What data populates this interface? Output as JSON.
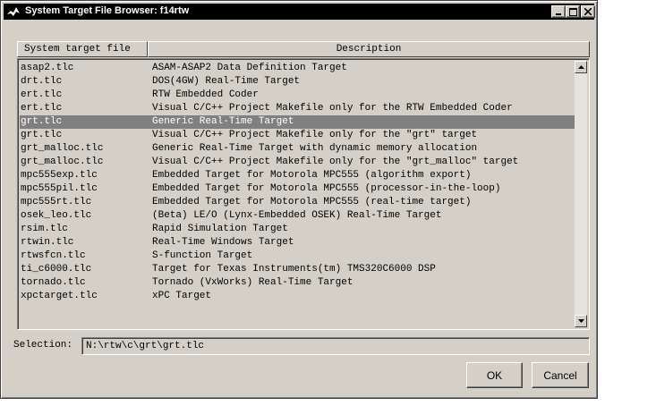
{
  "window": {
    "title": "System Target File Browser: f14rtw",
    "controls": {
      "minimize": "minimize-icon",
      "maximize": "maximize-icon",
      "close": "close-icon"
    }
  },
  "columns": {
    "file": "System target file",
    "description": "Description"
  },
  "rows": [
    {
      "file": "asap2.tlc",
      "description": "ASAM-ASAP2 Data Definition Target"
    },
    {
      "file": "drt.tlc",
      "description": "DOS(4GW) Real-Time Target"
    },
    {
      "file": "ert.tlc",
      "description": "RTW Embedded Coder"
    },
    {
      "file": "ert.tlc",
      "description": "Visual C/C++ Project Makefile only for the RTW Embedded Coder"
    },
    {
      "file": "grt.tlc",
      "description": "Generic Real-Time Target",
      "selected": true
    },
    {
      "file": "grt.tlc",
      "description": "Visual C/C++ Project Makefile only for the \"grt\" target"
    },
    {
      "file": "grt_malloc.tlc",
      "description": "Generic Real-Time Target with dynamic memory allocation"
    },
    {
      "file": "grt_malloc.tlc",
      "description": "Visual C/C++ Project Makefile only for the \"grt_malloc\" target"
    },
    {
      "file": "mpc555exp.tlc",
      "description": "Embedded Target for Motorola MPC555 (algorithm export)"
    },
    {
      "file": "mpc555pil.tlc",
      "description": "Embedded Target for Motorola MPC555 (processor-in-the-loop)"
    },
    {
      "file": "mpc555rt.tlc",
      "description": "Embedded Target for Motorola MPC555 (real-time target)"
    },
    {
      "file": "osek_leo.tlc",
      "description": "(Beta) LE/O (Lynx-Embedded OSEK) Real-Time Target"
    },
    {
      "file": "rsim.tlc",
      "description": "Rapid Simulation Target"
    },
    {
      "file": "rtwin.tlc",
      "description": "Real-Time Windows Target"
    },
    {
      "file": "rtwsfcn.tlc",
      "description": "S-function Target"
    },
    {
      "file": "ti_c6000.tlc",
      "description": "Target for Texas Instruments(tm) TMS320C6000 DSP"
    },
    {
      "file": "tornado.tlc",
      "description": "Tornado (VxWorks) Real-Time Target"
    },
    {
      "file": "xpctarget.tlc",
      "description": "xPC Target"
    }
  ],
  "selection": {
    "label": "Selection:",
    "value": "N:\\rtw\\c\\grt\\grt.tlc"
  },
  "buttons": {
    "ok": "OK",
    "cancel": "Cancel"
  },
  "colors": {
    "titlebar": "#000000",
    "face": "#d4d0c8",
    "selected_row": "#808080"
  }
}
